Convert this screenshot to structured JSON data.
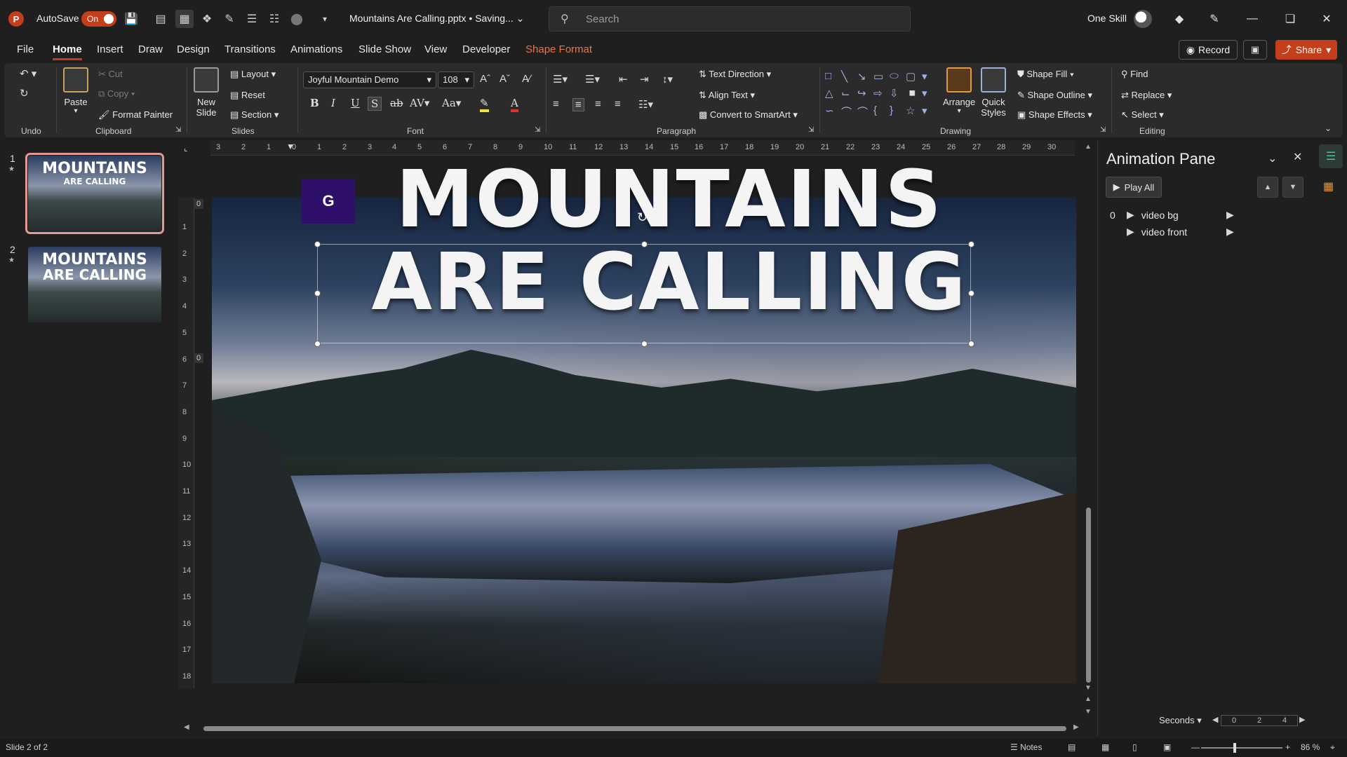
{
  "titlebar": {
    "autosave_label": "AutoSave",
    "autosave_state": "On",
    "document_title": "Mountains Are Calling.pptx • Saving...",
    "search_placeholder": "Search",
    "user_name": "One Skill"
  },
  "tabs": [
    "File",
    "Home",
    "Insert",
    "Draw",
    "Design",
    "Transitions",
    "Animations",
    "Slide Show",
    "View",
    "Developer",
    "Shape Format"
  ],
  "actions": {
    "record": "Record",
    "share": "Share"
  },
  "ribbon": {
    "undo_group": "Undo",
    "clipboard": {
      "label": "Clipboard",
      "paste": "Paste",
      "cut": "Cut",
      "copy": "Copy",
      "format_painter": "Format Painter"
    },
    "slides": {
      "label": "Slides",
      "new_slide_1": "New",
      "new_slide_2": "Slide",
      "layout": "Layout",
      "reset": "Reset",
      "section": "Section"
    },
    "font": {
      "label": "Font",
      "family": "Joyful Mountain Demo",
      "size": "108"
    },
    "paragraph": {
      "label": "Paragraph",
      "text_direction": "Text Direction",
      "align_text": "Align Text",
      "convert_smartart": "Convert to SmartArt"
    },
    "drawing": {
      "label": "Drawing",
      "arrange": "Arrange",
      "quick_styles_1": "Quick",
      "quick_styles_2": "Styles",
      "shape_fill": "Shape Fill",
      "shape_outline": "Shape Outline",
      "shape_effects": "Shape Effects"
    },
    "editing": {
      "label": "Editing",
      "find": "Find",
      "replace": "Replace",
      "select": "Select"
    }
  },
  "thumbnails": [
    {
      "number": "1",
      "line1": "MOUNTAINS",
      "line2": "ARE CALLING",
      "selected": true
    },
    {
      "number": "2",
      "line1": "MOUNTAINS",
      "line2": "ARE CALLING",
      "selected": false
    }
  ],
  "ruler": {
    "h_ticks": [
      "3",
      "2",
      "1",
      "0",
      "1",
      "2",
      "3",
      "4",
      "5",
      "6",
      "7",
      "8",
      "9",
      "10",
      "11",
      "12",
      "13",
      "14",
      "15",
      "16",
      "17",
      "18",
      "19",
      "20",
      "21",
      "22",
      "23",
      "24",
      "25",
      "26",
      "27",
      "28",
      "29",
      "30"
    ],
    "v_ticks": [
      "1",
      "2",
      "3",
      "4",
      "5",
      "6",
      "7",
      "8",
      "9",
      "10",
      "11",
      "12",
      "13",
      "14",
      "15",
      "16",
      "17",
      "18"
    ],
    "zero_top": "0",
    "zero_mid": "0"
  },
  "slide": {
    "headline_line1": "MOUNTAINS",
    "headline_line2": "ARE CALLING",
    "badge": "G"
  },
  "animation_pane": {
    "title": "Animation Pane",
    "play_all": "Play All",
    "items": [
      {
        "index": "0",
        "name": "video bg"
      },
      {
        "index": "",
        "name": "video front"
      }
    ],
    "seconds": "Seconds",
    "timeline_ticks": [
      "0",
      "2",
      "4"
    ]
  },
  "statusbar": {
    "slide_info": "Slide 2 of 2",
    "notes": "Notes",
    "zoom": "86 %"
  },
  "colors": {
    "accent": "#c43e1c",
    "shape_format": "#e8734f",
    "badge": "#2e0f6a"
  }
}
